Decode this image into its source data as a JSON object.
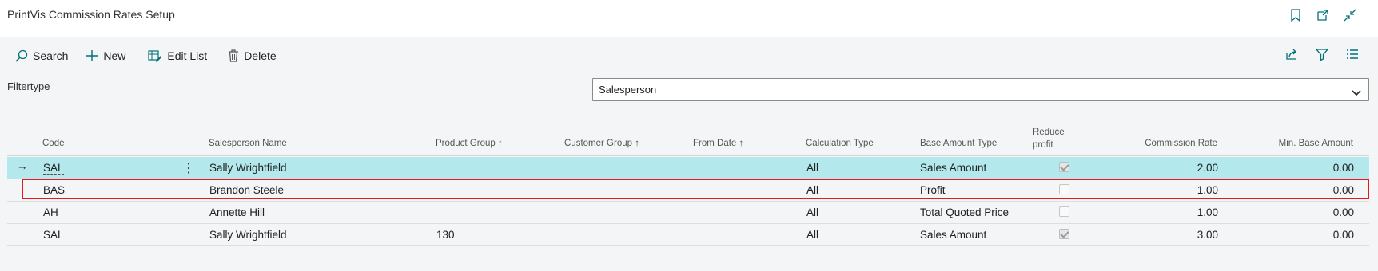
{
  "window": {
    "title": "PrintVis Commission Rates Setup"
  },
  "actions": {
    "search": "Search",
    "new": "New",
    "edit_list": "Edit List",
    "delete": "Delete"
  },
  "filter": {
    "label": "Filtertype",
    "value": "Salesperson"
  },
  "table": {
    "headers": {
      "code": "Code",
      "salesperson_name": "Salesperson Name",
      "product_group": "Product Group",
      "customer_group": "Customer Group",
      "from_date": "From Date",
      "calculation_type": "Calculation Type",
      "base_amount_type": "Base Amount Type",
      "reduce_profit_line1": "Reduce",
      "reduce_profit_line2": "profit",
      "commission_rate": "Commission Rate",
      "min_base_amount": "Min. Base Amount"
    },
    "rows": [
      {
        "code": "SAL",
        "name": "Sally Wrightfield",
        "product_group": "",
        "customer_group": "",
        "from_date": "",
        "calc_type": "All",
        "base_type": "Sales Amount",
        "reduce_profit": true,
        "rate": "2.00",
        "min_base": "0.00"
      },
      {
        "code": "BAS",
        "name": "Brandon Steele",
        "product_group": "",
        "customer_group": "",
        "from_date": "",
        "calc_type": "All",
        "base_type": "Profit",
        "reduce_profit": false,
        "rate": "1.00",
        "min_base": "0.00"
      },
      {
        "code": "AH",
        "name": "Annette Hill",
        "product_group": "",
        "customer_group": "",
        "from_date": "",
        "calc_type": "All",
        "base_type": "Total Quoted Price",
        "reduce_profit": false,
        "rate": "1.00",
        "min_base": "0.00"
      },
      {
        "code": "SAL",
        "name": "Sally Wrightfield",
        "product_group": "130",
        "customer_group": "",
        "from_date": "",
        "calc_type": "All",
        "base_type": "Sales Amount",
        "reduce_profit": true,
        "rate": "3.00",
        "min_base": "0.00"
      }
    ]
  },
  "colors": {
    "accent": "#00707a",
    "selected_row": "#b3e8ec",
    "highlight": "#e41a1a"
  }
}
